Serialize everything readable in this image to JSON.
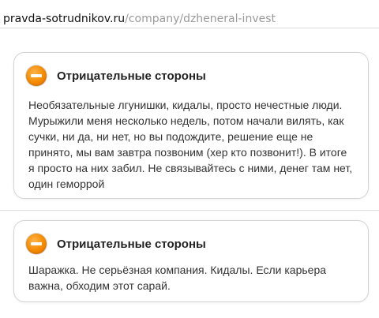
{
  "url_bar": {
    "domain": "pravda-sotrudnikov.ru",
    "path": "/company/dzheneral-invest"
  },
  "reviews": [
    {
      "icon": "minus-circle-icon",
      "title": "Отрицательные стороны",
      "text": "Необязательные лгунишки, кидалы, просто нечестные люди.\nМурыжили меня несколько недель, потом начали вилять, как\nсучки, ни да, ни нет, но вы подождите, решение еще не\nпринято, мы вам завтра позвоним (хер кто позвонит!). В итоге\nя просто на них забил. Не связывайтесь с ними, денег там нет,\nодин геморрой"
    },
    {
      "icon": "minus-circle-icon",
      "title": "Отрицательные стороны",
      "text": "Шаражка. Не серьёзная компания. Кидалы. Если карьера\nважна, обходим этот сарай."
    }
  ],
  "colors": {
    "accent": "#f38a00",
    "url_path": "#9a9a9a",
    "card_border": "#d4d4d4"
  }
}
